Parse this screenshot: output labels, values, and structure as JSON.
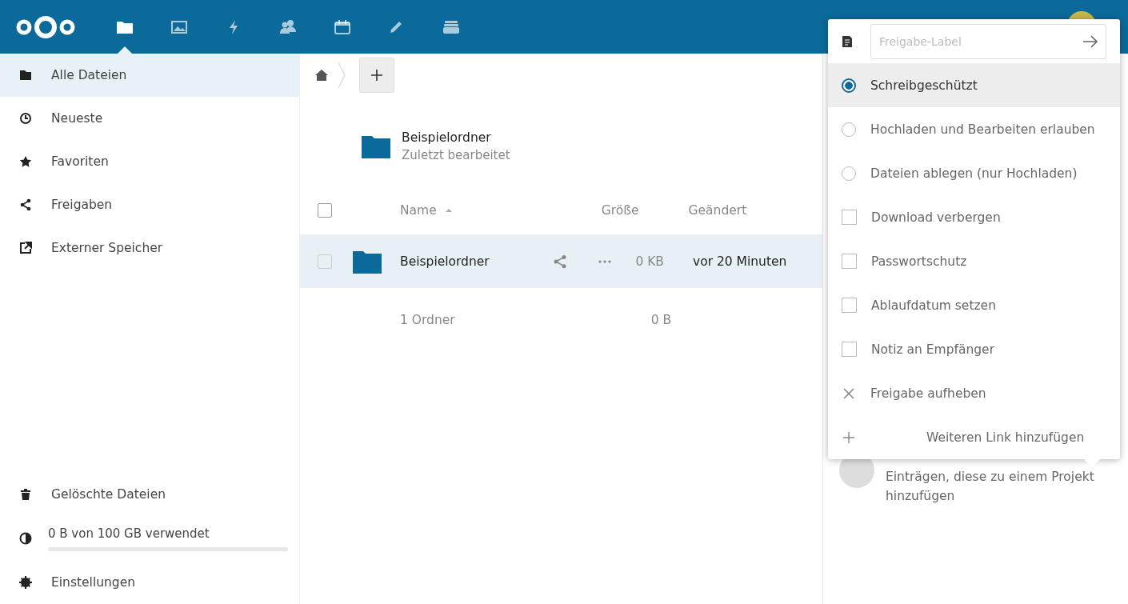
{
  "header": {
    "apps": [
      {
        "selected": true
      },
      {
        "selected": false
      },
      {
        "selected": false
      },
      {
        "selected": false
      },
      {
        "selected": false
      },
      {
        "selected": false
      },
      {
        "selected": false
      }
    ]
  },
  "sidebar": {
    "items": [
      {
        "label": "Alle Dateien",
        "selected": true
      },
      {
        "label": "Neueste",
        "selected": false
      },
      {
        "label": "Favoriten",
        "selected": false
      },
      {
        "label": "Freigaben",
        "selected": false
      },
      {
        "label": "Externer Speicher",
        "selected": false
      }
    ],
    "trash": "Gelöschte Dateien",
    "quota": {
      "label": "0 B von 100 GB verwendet",
      "level": 0
    },
    "settings": "Einstellungen"
  },
  "recent": {
    "name": "Beispielordner",
    "subtitle": "Zuletzt bearbeitet"
  },
  "table": {
    "select_all_checked": false,
    "columns": [
      "Name",
      "Größe",
      "Geändert"
    ],
    "rows": [
      {
        "name": "Beispielordner",
        "size": "0 KB",
        "modified": "vor 20 Minuten",
        "selected": false,
        "highlighted": true
      }
    ],
    "summary": {
      "count": "1 Ordner",
      "size": "0 B"
    }
  },
  "details": {
    "text_lines": [
      "Einträgen, diese zu einem Projekt",
      "hinzufügen"
    ]
  },
  "share_menu": {
    "label_field": {
      "placeholder": "Freigabe-Label"
    },
    "items": [
      {
        "kind": "radio",
        "label": "Schreibgeschützt",
        "selected": true
      },
      {
        "kind": "radio",
        "label": "Hochladen und Bearbeiten erlauben",
        "selected": false
      },
      {
        "kind": "radio",
        "label": "Dateien ablegen (nur Hochladen)",
        "selected": false
      },
      {
        "kind": "checkbox",
        "label": "Download verbergen",
        "checked": false
      },
      {
        "kind": "checkbox",
        "label": "Passwortschutz",
        "checked": false
      },
      {
        "kind": "checkbox",
        "label": "Ablaufdatum setzen",
        "checked": false
      },
      {
        "kind": "checkbox",
        "label": "Notiz an Empfänger",
        "checked": false
      },
      {
        "kind": "unshare",
        "label": "Freigabe aufheben"
      },
      {
        "kind": "add",
        "label": "Weiteren Link hinzufügen"
      }
    ]
  }
}
